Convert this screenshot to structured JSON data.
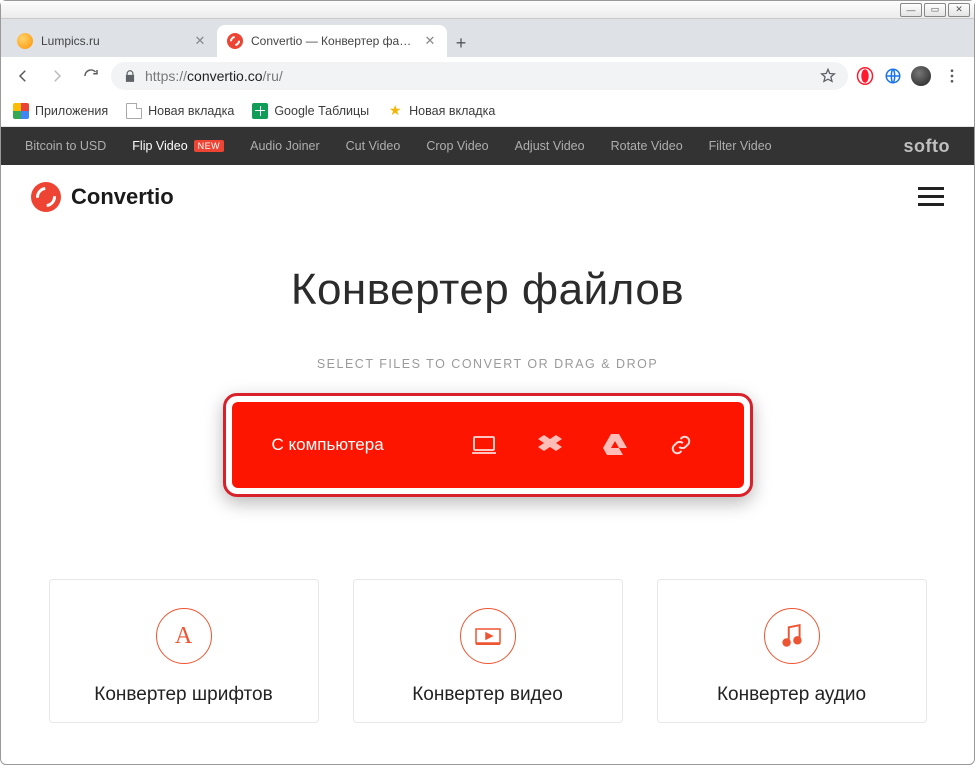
{
  "window": {
    "tabs": [
      {
        "label": "Lumpics.ru",
        "active": false
      },
      {
        "label": "Convertio — Конвертер файлов",
        "active": true
      }
    ]
  },
  "address": {
    "scheme": "https://",
    "host": "convertio.co",
    "path": "/ru/"
  },
  "bookmarks": [
    {
      "label": "Приложения",
      "icon": "apps"
    },
    {
      "label": "Новая вкладка",
      "icon": "file"
    },
    {
      "label": "Google Таблицы",
      "icon": "sheets"
    },
    {
      "label": "Новая вкладка",
      "icon": "star"
    }
  ],
  "darkbar": {
    "items": [
      {
        "label": "Bitcoin to USD"
      },
      {
        "label": "Flip Video",
        "new": true
      },
      {
        "label": "Audio Joiner"
      },
      {
        "label": "Cut Video"
      },
      {
        "label": "Crop Video"
      },
      {
        "label": "Adjust Video"
      },
      {
        "label": "Rotate Video"
      },
      {
        "label": "Filter Video"
      }
    ],
    "brand": "softo"
  },
  "site": {
    "brand": "Convertio"
  },
  "hero": {
    "title": "Конвертер файлов",
    "subline": "SELECT FILES TO CONVERT OR DRAG & DROP"
  },
  "upload": {
    "main_label": "С компьютера"
  },
  "cards": [
    {
      "title": "Конвертер шрифтов",
      "letter": "A"
    },
    {
      "title": "Конвертер видео"
    },
    {
      "title": "Конвертер аудио"
    }
  ]
}
